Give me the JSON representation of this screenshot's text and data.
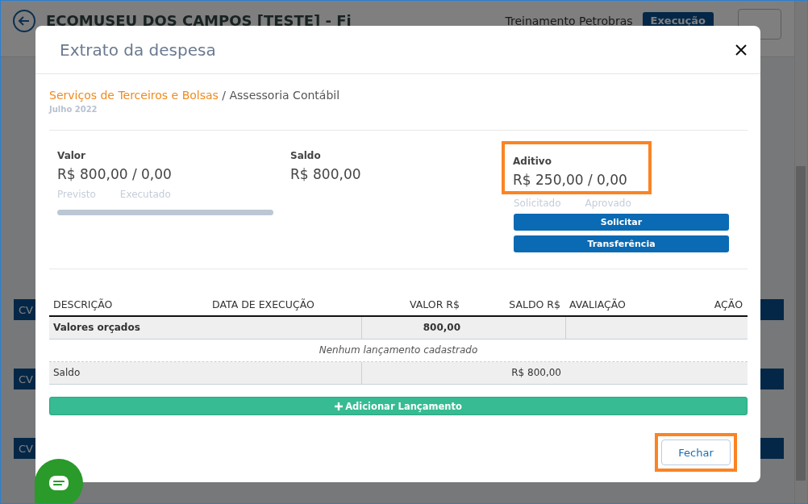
{
  "background": {
    "title": "ECOMUSEU DOS CAMPOS [TESTE] - Fi",
    "client": "Treinamento Petrobras",
    "status": "Execução",
    "row_labels": [
      "CV",
      "CV",
      "CV"
    ]
  },
  "modal": {
    "title": "Extrato da despesa",
    "category": "Serviços de Terceiros e Bolsas",
    "separator": "/",
    "subcategory": "Assessoria Contábil",
    "period": "Julho 2022",
    "stats": [
      {
        "kind": "progress",
        "label": "Valor",
        "amount": "R$ 800,00 / 0,00",
        "legend": [
          "Previsto",
          "Executado"
        ],
        "level": 0
      },
      {
        "kind": "plain",
        "label": "Saldo",
        "amount": "R$ 800,00"
      },
      {
        "kind": "actions",
        "label": "Aditivo",
        "amount": "R$ 250,00 / 0,00",
        "legend": [
          "Solicitado",
          "Aprovado"
        ],
        "buttons": [
          "Solicitar",
          "Transferência"
        ],
        "highlighted": true
      }
    ],
    "table": {
      "columns": [
        "DESCRIÇÃO",
        "DATA DE EXECUÇÃO",
        "VALOR R$",
        "SALDO R$",
        "AVALIAÇÃO",
        "AÇÃO"
      ],
      "rows": [
        {
          "kind": "budget",
          "description": "Valores orçados",
          "value": "800,00"
        },
        {
          "kind": "empty",
          "text": "Nenhum lançamento cadastrado"
        },
        {
          "kind": "balance",
          "description": "Saldo",
          "balance": "R$ 800,00"
        }
      ]
    },
    "add_button": "Adicionar Lançamento",
    "close_button": {
      "label": "Fechar",
      "highlighted": true
    }
  }
}
